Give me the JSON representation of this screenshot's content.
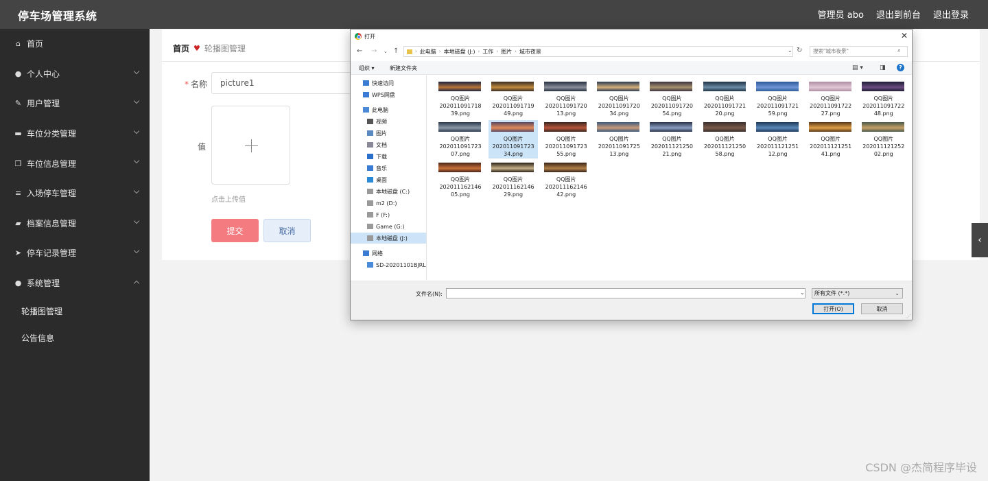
{
  "header": {
    "app_title": "停车场管理系统",
    "admin_label": "管理员 abo",
    "exit_front_label": "退出到前台",
    "logout_label": "退出登录"
  },
  "sidebar": {
    "items": [
      {
        "label": "首页",
        "icon": "home-icon"
      },
      {
        "label": "个人中心",
        "icon": "user-icon"
      },
      {
        "label": "用户管理",
        "icon": "edit-icon"
      },
      {
        "label": "车位分类管理",
        "icon": "monitor-icon"
      },
      {
        "label": "车位信息管理",
        "icon": "copy-icon"
      },
      {
        "label": "入场停车管理",
        "icon": "list-icon"
      },
      {
        "label": "档案信息管理",
        "icon": "bag-icon"
      },
      {
        "label": "停车记录管理",
        "icon": "send-icon"
      },
      {
        "label": "系统管理",
        "icon": "user-icon"
      }
    ],
    "subitems": [
      {
        "label": "轮播图管理"
      },
      {
        "label": "公告信息"
      }
    ]
  },
  "breadcrumb": {
    "home": "首页",
    "current": "轮播图管理"
  },
  "form": {
    "name_label": "名称",
    "name_value": "picture1",
    "value_label": "值",
    "upload_hint": "点击上传值",
    "submit_label": "提交",
    "cancel_label": "取消"
  },
  "dialog": {
    "title": "打开",
    "path": [
      "此电脑",
      "本地磁盘 (J:)",
      "工作",
      "图片",
      "城市夜景"
    ],
    "search_placeholder": "搜索\"城市夜景\"",
    "organize_label": "组织 ▾",
    "new_folder_label": "新建文件夹",
    "nav": [
      {
        "label": "快速访问",
        "icon": "star-icon",
        "indent": 1
      },
      {
        "label": "WPS网盘",
        "icon": "cloud-icon",
        "indent": 1
      },
      {
        "label": "此电脑",
        "icon": "pc-icon",
        "indent": 1
      },
      {
        "label": "视频",
        "icon": "video-icon",
        "indent": 2
      },
      {
        "label": "图片",
        "icon": "picture-icon",
        "indent": 2
      },
      {
        "label": "文档",
        "icon": "document-icon",
        "indent": 2
      },
      {
        "label": "下载",
        "icon": "download-icon",
        "indent": 2
      },
      {
        "label": "音乐",
        "icon": "music-icon",
        "indent": 2
      },
      {
        "label": "桌面",
        "icon": "desktop-icon",
        "indent": 2
      },
      {
        "label": "本地磁盘 (C:)",
        "icon": "drive-icon",
        "indent": 2
      },
      {
        "label": "m2 (D:)",
        "icon": "drive-icon",
        "indent": 2
      },
      {
        "label": "F (F:)",
        "icon": "drive-icon",
        "indent": 2
      },
      {
        "label": "Game (G:)",
        "icon": "drive-icon",
        "indent": 2
      },
      {
        "label": "本地磁盘 (J:)",
        "icon": "drive-icon",
        "indent": 2,
        "selected": true
      },
      {
        "label": "网络",
        "icon": "network-icon",
        "indent": 1
      },
      {
        "label": "SD-20201101BJRL",
        "icon": "network-pc-icon",
        "indent": 2
      }
    ],
    "files": [
      {
        "name": "QQ图片\n202011091718\n39.png",
        "c1": "#1d2540",
        "c2": "#b9743a"
      },
      {
        "name": "QQ图片\n202011091719\n49.png",
        "c1": "#3a2d25",
        "c2": "#c08a3c"
      },
      {
        "name": "QQ图片\n202011091720\n13.png",
        "c1": "#26303f",
        "c2": "#8b8f9c"
      },
      {
        "name": "QQ图片\n202011091720\n34.png",
        "c1": "#2a3a52",
        "c2": "#d3b07a"
      },
      {
        "name": "QQ图片\n202011091720\n54.png",
        "c1": "#3b3440",
        "c2": "#a7906e"
      },
      {
        "name": "QQ图片\n202011091721\n20.png",
        "c1": "#1e3346",
        "c2": "#6b8ca5"
      },
      {
        "name": "QQ图片\n202011091721\n59.png",
        "c1": "#2e5a98",
        "c2": "#6f95d6"
      },
      {
        "name": "QQ图片\n202011091722\n27.png",
        "c1": "#b08ea2",
        "c2": "#e0c8d6"
      },
      {
        "name": "QQ图片\n202011091722\n48.png",
        "c1": "#1f1d34",
        "c2": "#6a4c80"
      },
      {
        "name": "QQ图片\n202011091723\n07.png",
        "c1": "#2d3a4d",
        "c2": "#8c9aa8"
      },
      {
        "name": "QQ图片\n202011091723\n34.png",
        "c1": "#5b4860",
        "c2": "#e28b5a",
        "selected": true
      },
      {
        "name": "QQ图片\n202011091723\n55.png",
        "c1": "#3a2620",
        "c2": "#b9563a"
      },
      {
        "name": "QQ图片\n202011091725\n13.png",
        "c1": "#3c5a7c",
        "c2": "#c89a7a"
      },
      {
        "name": "QQ图片\n202011121250\n21.png",
        "c1": "#2a3248",
        "c2": "#8aa0c4"
      },
      {
        "name": "QQ图片\n202011121250\n58.png",
        "c1": "#3a2e2c",
        "c2": "#7a5a4a"
      },
      {
        "name": "QQ图片\n202011121251\n12.png",
        "c1": "#1e3a5a",
        "c2": "#5a88b8"
      },
      {
        "name": "QQ图片\n202011121251\n41.png",
        "c1": "#5a3818",
        "c2": "#e0a048"
      },
      {
        "name": "QQ图片\n202011121252\n02.png",
        "c1": "#4a5a4a",
        "c2": "#c8a068"
      },
      {
        "name": "QQ图片\n202011162146\n05.png",
        "c1": "#4a2418",
        "c2": "#c8703a"
      },
      {
        "name": "QQ图片\n202011162146\n29.png",
        "c1": "#2a2218",
        "c2": "#c8b088"
      },
      {
        "name": "QQ图片\n202011162146\n42.png",
        "c1": "#3a2418",
        "c2": "#b08048"
      }
    ],
    "filename_label": "文件名(N):",
    "filename_value": "",
    "filetype_value": "所有文件 (*.*)",
    "open_label": "打开(O)",
    "cancel_label": "取消"
  },
  "watermark": "CSDN @杰简程序毕设",
  "colors": {
    "header_bg": "#444444",
    "sidebar_bg": "#2b2b2b",
    "submit_bg": "#f47b80",
    "cancel_bg": "#e6eef9"
  }
}
